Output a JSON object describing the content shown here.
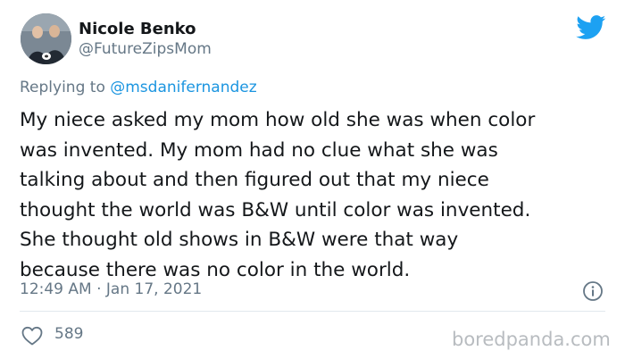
{
  "user": {
    "name": "Nicole Benko",
    "handle": "@FutureZipsMom"
  },
  "reply": {
    "prefix": "Replying to ",
    "mention": "@msdanifernandez"
  },
  "tweet": {
    "lines": [
      "My niece asked my mom how old she was when color",
      "was invented. My mom had no clue what she was",
      "talking about and then figured out that my niece",
      "thought the world was B&W until color was invented.",
      "She thought old shows in B&W were that way",
      "because there was no color in the world."
    ],
    "timestamp": "12:49 AM · Jan 17, 2021",
    "likes": "589"
  },
  "icons": {
    "brand": "twitter-bird-icon",
    "info": "info-icon",
    "like": "heart-icon"
  },
  "watermark": "boredpanda.com",
  "colors": {
    "brand_blue": "#1da1f2",
    "link_blue": "#1b95e0",
    "secondary_text": "#657786",
    "primary_text": "#14171a",
    "divider": "#e1e8ed"
  }
}
